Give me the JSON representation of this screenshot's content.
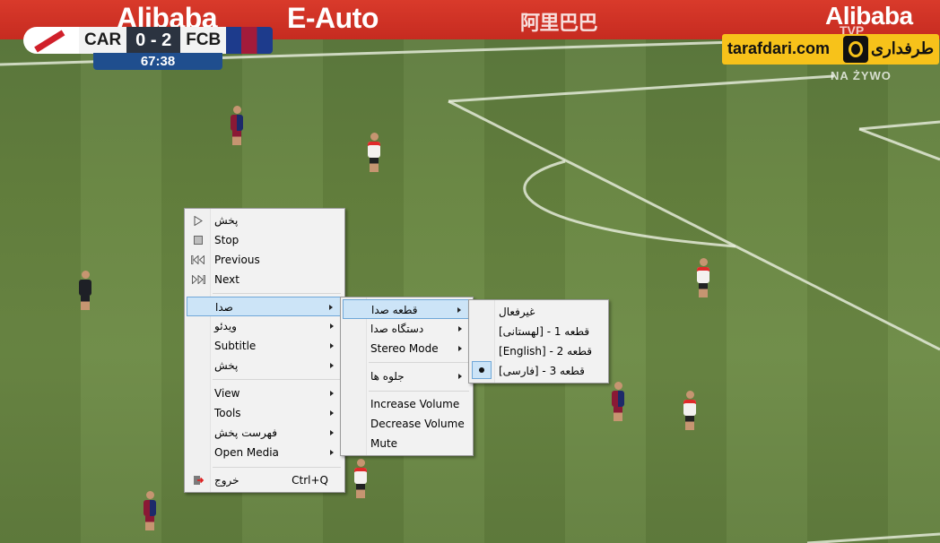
{
  "broadcast": {
    "ads": [
      "Alibaba",
      "E-Auto",
      "阿里巴巴",
      "Alibaba"
    ],
    "scoreboard": {
      "home": "CAR",
      "score": "0 - 2",
      "away": "FCB",
      "clock": "67:38"
    },
    "watermark": {
      "site_en": "tarafdari.com",
      "site_fa": "طرفداری"
    },
    "channel_logo": "TVP",
    "live_label": "NA ŻYWO"
  },
  "main_menu": {
    "items": [
      {
        "label": "پخش",
        "icon": "play-icon"
      },
      {
        "label": "Stop",
        "icon": "stop-icon"
      },
      {
        "label": "Previous",
        "icon": "previous-icon"
      },
      {
        "label": "Next",
        "icon": "next-icon"
      },
      {
        "label": "صدا",
        "submenu": true,
        "highlighted": true
      },
      {
        "label": "ویدئو",
        "submenu": true
      },
      {
        "label": "Subtitle",
        "submenu": true
      },
      {
        "label": "پخش",
        "submenu": true
      },
      {
        "label": "View",
        "submenu": true
      },
      {
        "label": "Tools",
        "submenu": true
      },
      {
        "label": "فهرست پخش",
        "submenu": true
      },
      {
        "label": "Open Media",
        "submenu": true
      },
      {
        "label": "خروج",
        "shortcut": "Ctrl+Q",
        "icon": "exit-icon"
      }
    ]
  },
  "audio_menu": {
    "items": [
      {
        "label": "قطعه صدا",
        "submenu": true,
        "highlighted": true
      },
      {
        "label": "دستگاه صدا",
        "submenu": true
      },
      {
        "label": "Stereo Mode",
        "submenu": true
      },
      {
        "label": "جلوه ها",
        "submenu": true
      },
      {
        "label": "Increase Volume"
      },
      {
        "label": "Decrease Volume"
      },
      {
        "label": "Mute"
      }
    ]
  },
  "track_menu": {
    "items": [
      {
        "label": "غیرفعال"
      },
      {
        "label": "قطعه 1 - [لهستانی]"
      },
      {
        "label": "قطعه 2 - [English]"
      },
      {
        "label": "قطعه 3 - [فارسی]",
        "selected": true
      }
    ]
  }
}
